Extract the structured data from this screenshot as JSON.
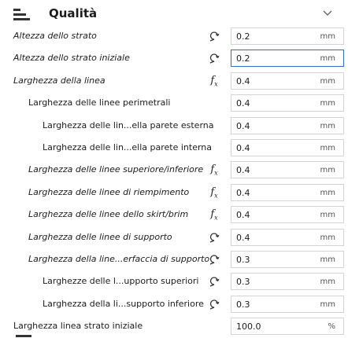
{
  "header": {
    "title": "Qualità",
    "icon": "category-layers-icon",
    "collapse_icon": "chevron-down-icon"
  },
  "settings": [
    {
      "label": "Altezza dello strato",
      "italic": true,
      "indent": 0,
      "icon": "reset-icon",
      "value": "0.2",
      "unit": "mm",
      "active": false
    },
    {
      "label": "Altezza dello strato iniziale",
      "italic": true,
      "indent": 0,
      "icon": "reset-icon",
      "value": "0.2",
      "unit": "mm",
      "active": true
    },
    {
      "label": "Larghezza della linea",
      "italic": true,
      "indent": 0,
      "icon": "function-icon",
      "value": "0.4",
      "unit": "mm",
      "active": false
    },
    {
      "label": "Larghezza delle linee perimetrali",
      "italic": false,
      "indent": 1,
      "icon": "",
      "value": "0.4",
      "unit": "mm",
      "active": false
    },
    {
      "label": "Larghezza delle lin...ella parete esterna",
      "italic": false,
      "indent": 2,
      "icon": "",
      "value": "0.4",
      "unit": "mm",
      "active": false
    },
    {
      "label": "Larghezza delle lin...ella parete interna",
      "italic": false,
      "indent": 2,
      "icon": "",
      "value": "0.4",
      "unit": "mm",
      "active": false
    },
    {
      "label": "Larghezza delle linee superiore/inferiore",
      "italic": true,
      "indent": 1,
      "icon": "function-icon",
      "value": "0.4",
      "unit": "mm",
      "active": false
    },
    {
      "label": "Larghezza delle linee di riempimento",
      "italic": true,
      "indent": 1,
      "icon": "function-icon",
      "value": "0.4",
      "unit": "mm",
      "active": false
    },
    {
      "label": "Larghezza delle linee dello skirt/brim",
      "italic": true,
      "indent": 1,
      "icon": "function-icon",
      "value": "0.4",
      "unit": "mm",
      "active": false
    },
    {
      "label": "Larghezza delle linee di supporto",
      "italic": true,
      "indent": 1,
      "icon": "reset-icon",
      "value": "0.4",
      "unit": "mm",
      "active": false
    },
    {
      "label": "Larghezza della line...erfaccia di supporto",
      "italic": true,
      "indent": 1,
      "icon": "reset-icon",
      "value": "0.3",
      "unit": "mm",
      "active": false
    },
    {
      "label": "Larghezze delle l...upporto superiori",
      "italic": false,
      "indent": 2,
      "icon": "reset-icon",
      "value": "0.3",
      "unit": "mm",
      "active": false
    },
    {
      "label": "Larghezza della li...supporto inferiore",
      "italic": false,
      "indent": 2,
      "icon": "reset-icon",
      "value": "0.3",
      "unit": "mm",
      "active": false
    },
    {
      "label": "Larghezza linea strato iniziale",
      "italic": false,
      "indent": 0,
      "icon": "",
      "value": "100.0",
      "unit": "%",
      "active": false
    }
  ]
}
